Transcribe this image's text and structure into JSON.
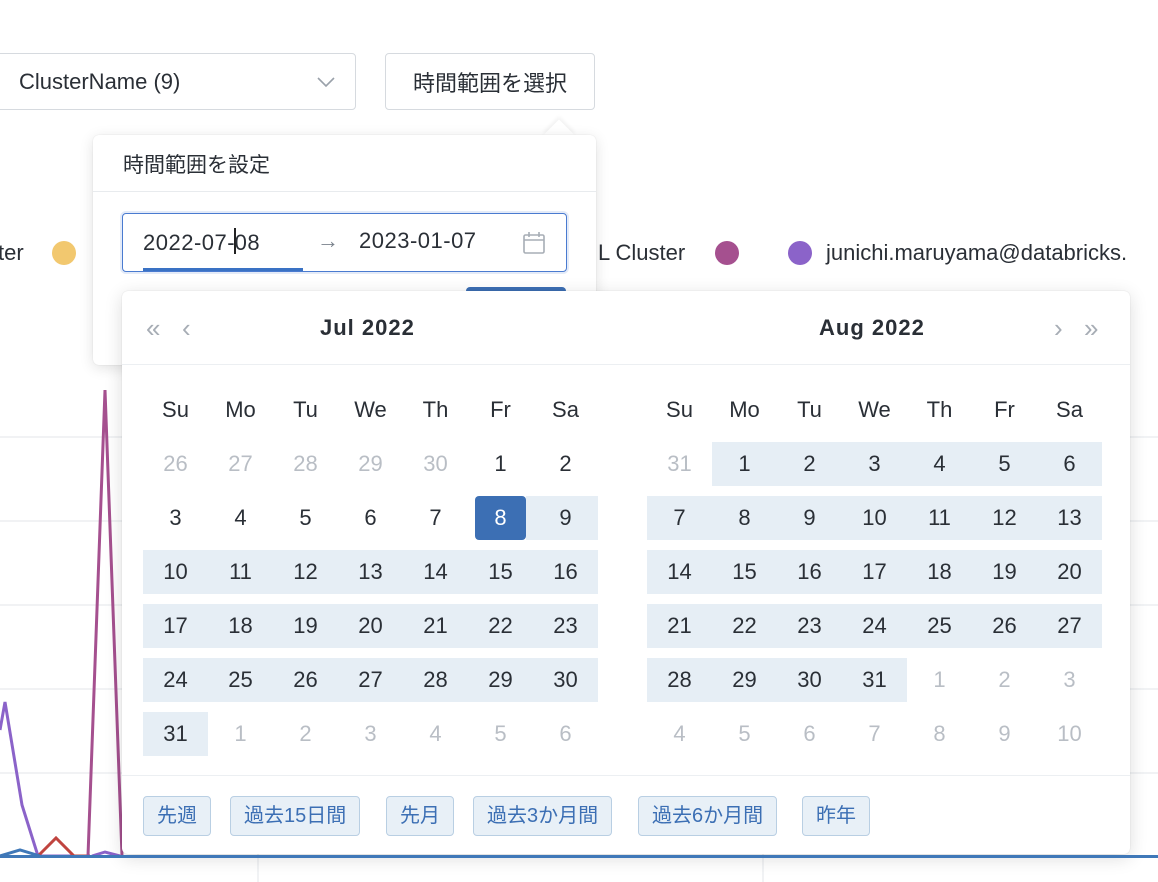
{
  "toolbar": {
    "cluster_select_value": "ClusterName (9)",
    "time_range_button": "時間範囲を選択"
  },
  "legend": {
    "left_partial": "ter",
    "cluster_partial": "L Cluster",
    "user": "junichi.maruyama@databricks.",
    "colors": [
      "#f2c86f",
      "#a5508f",
      "#8b63c9"
    ]
  },
  "popover": {
    "title": "時間範囲を設定",
    "start_date_before_caret": "2022-07-",
    "start_date_after_caret": "08",
    "range_separator": "→",
    "end_date": "2023-01-07"
  },
  "calendar": {
    "left_month": "Jul  2022",
    "right_month": "Aug  2022",
    "prev_year": "«",
    "prev_month": "‹",
    "next_month": "›",
    "next_year": "»",
    "weekdays": [
      "Su",
      "Mo",
      "Tu",
      "We",
      "Th",
      "Fr",
      "Sa"
    ],
    "accent_color": "#3c6fb4",
    "range_color": "#e6eef5",
    "selected_day": "8",
    "left_weeks": [
      [
        {
          "d": "26",
          "s": "muted"
        },
        {
          "d": "27",
          "s": "muted"
        },
        {
          "d": "28",
          "s": "muted"
        },
        {
          "d": "29",
          "s": "muted"
        },
        {
          "d": "30",
          "s": "muted"
        },
        {
          "d": "1",
          "s": ""
        },
        {
          "d": "2",
          "s": ""
        }
      ],
      [
        {
          "d": "3",
          "s": ""
        },
        {
          "d": "4",
          "s": ""
        },
        {
          "d": "5",
          "s": ""
        },
        {
          "d": "6",
          "s": ""
        },
        {
          "d": "7",
          "s": ""
        },
        {
          "d": "8",
          "s": "selected"
        },
        {
          "d": "9",
          "s": "inrange"
        }
      ],
      [
        {
          "d": "10",
          "s": "inrange"
        },
        {
          "d": "11",
          "s": "inrange"
        },
        {
          "d": "12",
          "s": "inrange"
        },
        {
          "d": "13",
          "s": "inrange"
        },
        {
          "d": "14",
          "s": "inrange"
        },
        {
          "d": "15",
          "s": "inrange"
        },
        {
          "d": "16",
          "s": "inrange"
        }
      ],
      [
        {
          "d": "17",
          "s": "inrange"
        },
        {
          "d": "18",
          "s": "inrange"
        },
        {
          "d": "19",
          "s": "inrange"
        },
        {
          "d": "20",
          "s": "inrange"
        },
        {
          "d": "21",
          "s": "inrange"
        },
        {
          "d": "22",
          "s": "inrange"
        },
        {
          "d": "23",
          "s": "inrange"
        }
      ],
      [
        {
          "d": "24",
          "s": "inrange"
        },
        {
          "d": "25",
          "s": "inrange"
        },
        {
          "d": "26",
          "s": "inrange"
        },
        {
          "d": "27",
          "s": "inrange"
        },
        {
          "d": "28",
          "s": "inrange"
        },
        {
          "d": "29",
          "s": "inrange"
        },
        {
          "d": "30",
          "s": "inrange"
        }
      ],
      [
        {
          "d": "31",
          "s": "inrange"
        },
        {
          "d": "1",
          "s": "muted"
        },
        {
          "d": "2",
          "s": "muted"
        },
        {
          "d": "3",
          "s": "muted"
        },
        {
          "d": "4",
          "s": "muted"
        },
        {
          "d": "5",
          "s": "muted"
        },
        {
          "d": "6",
          "s": "muted"
        }
      ]
    ],
    "right_weeks": [
      [
        {
          "d": "31",
          "s": "muted"
        },
        {
          "d": "1",
          "s": "inrange"
        },
        {
          "d": "2",
          "s": "inrange"
        },
        {
          "d": "3",
          "s": "inrange"
        },
        {
          "d": "4",
          "s": "inrange"
        },
        {
          "d": "5",
          "s": "inrange"
        },
        {
          "d": "6",
          "s": "inrange"
        }
      ],
      [
        {
          "d": "7",
          "s": "inrange"
        },
        {
          "d": "8",
          "s": "inrange"
        },
        {
          "d": "9",
          "s": "inrange"
        },
        {
          "d": "10",
          "s": "inrange"
        },
        {
          "d": "11",
          "s": "inrange"
        },
        {
          "d": "12",
          "s": "inrange"
        },
        {
          "d": "13",
          "s": "inrange"
        }
      ],
      [
        {
          "d": "14",
          "s": "inrange"
        },
        {
          "d": "15",
          "s": "inrange"
        },
        {
          "d": "16",
          "s": "inrange"
        },
        {
          "d": "17",
          "s": "inrange"
        },
        {
          "d": "18",
          "s": "inrange"
        },
        {
          "d": "19",
          "s": "inrange"
        },
        {
          "d": "20",
          "s": "inrange"
        }
      ],
      [
        {
          "d": "21",
          "s": "inrange"
        },
        {
          "d": "22",
          "s": "inrange"
        },
        {
          "d": "23",
          "s": "inrange"
        },
        {
          "d": "24",
          "s": "inrange"
        },
        {
          "d": "25",
          "s": "inrange"
        },
        {
          "d": "26",
          "s": "inrange"
        },
        {
          "d": "27",
          "s": "inrange"
        }
      ],
      [
        {
          "d": "28",
          "s": "inrange"
        },
        {
          "d": "29",
          "s": "inrange"
        },
        {
          "d": "30",
          "s": "inrange"
        },
        {
          "d": "31",
          "s": "inrange"
        },
        {
          "d": "1",
          "s": "muted"
        },
        {
          "d": "2",
          "s": "muted"
        },
        {
          "d": "3",
          "s": "muted"
        }
      ],
      [
        {
          "d": "4",
          "s": "muted"
        },
        {
          "d": "5",
          "s": "muted"
        },
        {
          "d": "6",
          "s": "muted"
        },
        {
          "d": "7",
          "s": "muted"
        },
        {
          "d": "8",
          "s": "muted"
        },
        {
          "d": "9",
          "s": "muted"
        },
        {
          "d": "10",
          "s": "muted"
        }
      ]
    ],
    "presets": [
      "先週",
      "過去15日間",
      "先月",
      "過去3か月間",
      "過去6か月間",
      "昨年"
    ]
  }
}
